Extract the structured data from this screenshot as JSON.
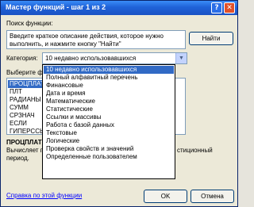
{
  "window": {
    "title": "Мастер функций - шаг 1 из 2",
    "help_glyph": "?",
    "close_glyph": "✕"
  },
  "search": {
    "label": "Поиск функции:",
    "description_lines": [
      "Введите краткое описание действия, которое нужно",
      "выполнить, и нажмите кнопку \"Найти\""
    ],
    "find_button": "Найти"
  },
  "category": {
    "label": "Категория:",
    "selected": "10 недавно использовавшихся",
    "options": [
      "10 недавно использовавшихся",
      "Полный алфавитный перечень",
      "Финансовые",
      "Дата и время",
      "Математические",
      "Статистические",
      "Ссылки и массивы",
      "Работа с базой данных",
      "Текстовые",
      "Логические",
      "Проверка свойств и значений",
      "Определенные пользователем"
    ]
  },
  "functions": {
    "label": "Выберите фу",
    "items": [
      "ПРОЦПЛАТ",
      "ПЛТ",
      "РАДИАНЫ",
      "СУММ",
      "СРЗНАЧ",
      "ЕСЛИ",
      "ГИПЕРССЫ"
    ]
  },
  "selected_function": {
    "name": "ПРОЦПЛАТ",
    "description_start": "Вычисляет п",
    "description_end_1": "стиционный",
    "description_end_2": "период."
  },
  "footer": {
    "help_link": "Справка по этой функции",
    "ok_button": "OK",
    "cancel_button": "Отмена"
  }
}
